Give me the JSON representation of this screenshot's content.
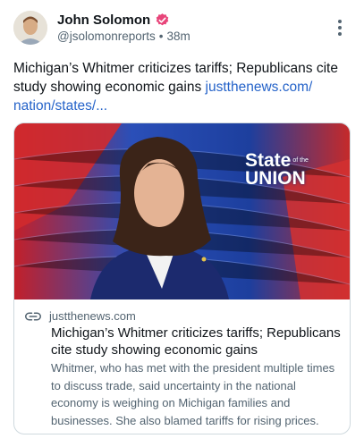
{
  "author": {
    "name": "John Solomon",
    "handle": "@jsolomonreports",
    "separator": "•",
    "time": "38m"
  },
  "post": {
    "text": "Michigan’s Whitmer criticizes tariffs; Republicans cite study showing economic gains",
    "link_text": "justthenews.com/ nation/states/..."
  },
  "card": {
    "image": {
      "overlay_text_1": "State",
      "overlay_small": "of the",
      "overlay_text_2": "UNION"
    },
    "domain": "justthenews.com",
    "title": "Michigan’s Whitmer criticizes tariffs; Republicans cite study showing economic gains",
    "description": "Whitmer, who has met with the president multiple times to discuss trade, said uncertainty in the national economy is weighing on Michigan families and businesses. She also blamed tariffs for rising prices."
  },
  "icons": {
    "verified": "verified-badge-icon",
    "more": "more-options-icon",
    "link": "link-icon"
  },
  "colors": {
    "verified": "#e8457a",
    "link": "#2563c9",
    "secondary_text": "#536471"
  }
}
